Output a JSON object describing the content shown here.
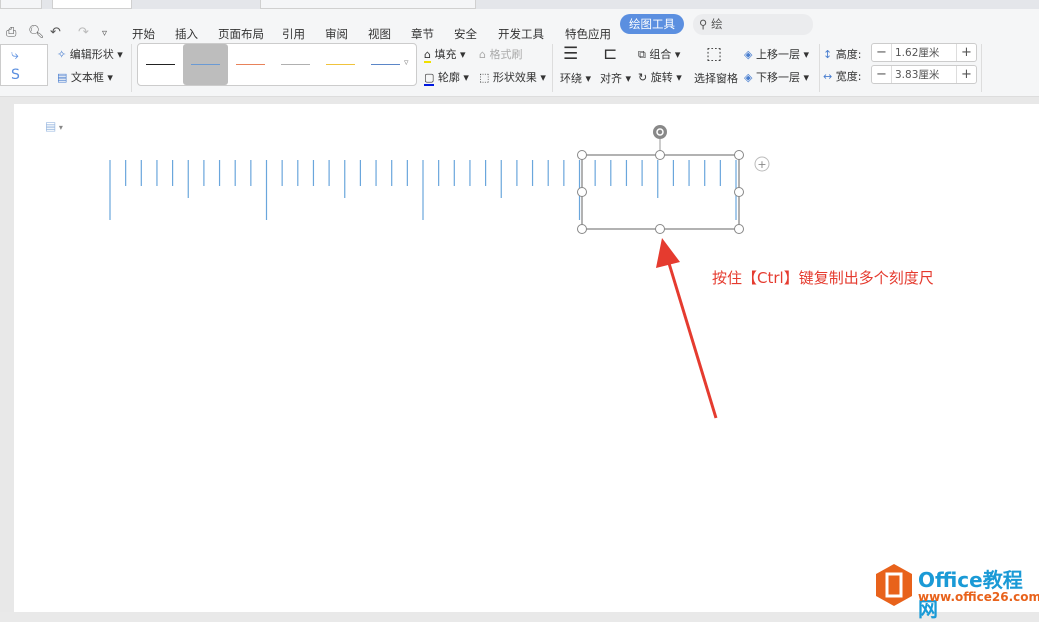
{
  "menu": {
    "items": [
      "开始",
      "插入",
      "页面布局",
      "引用",
      "审阅",
      "视图",
      "章节",
      "安全",
      "开发工具",
      "特色应用"
    ],
    "active_tab": "绘图工具",
    "search_text": "绘"
  },
  "ribbon": {
    "edit_shape": "编辑形状",
    "text_box": "文本框",
    "line_styles": [
      {
        "color": "#222222"
      },
      {
        "color": "#6a9ad4",
        "selected": true
      },
      {
        "color": "#e8825a"
      },
      {
        "color": "#b0b0b0"
      },
      {
        "color": "#f0c33c"
      },
      {
        "color": "#5b86c8"
      }
    ],
    "fill": "填充",
    "format_painter": "格式刷",
    "outline": "轮廓",
    "shape_effects": "形状效果",
    "wrap": "环绕",
    "align": "对齐",
    "group": "组合",
    "rotate": "旋转",
    "selection_pane": "选择窗格",
    "bring_forward": "上移一层",
    "send_backward": "下移一层",
    "height_label": "高度:",
    "height_value": "1.62厘米",
    "width_label": "宽度:",
    "width_value": "3.83厘米"
  },
  "annotation": {
    "text": "按住【Ctrl】键复制出多个刻度尺",
    "color": "#e53b2f"
  },
  "ruler": {
    "color": "#6aa6dc"
  },
  "watermark": {
    "brand": "Office教程网",
    "url": "www.office26.com",
    "color_brand": "#1a9ad6",
    "color_url": "#e8621b"
  }
}
